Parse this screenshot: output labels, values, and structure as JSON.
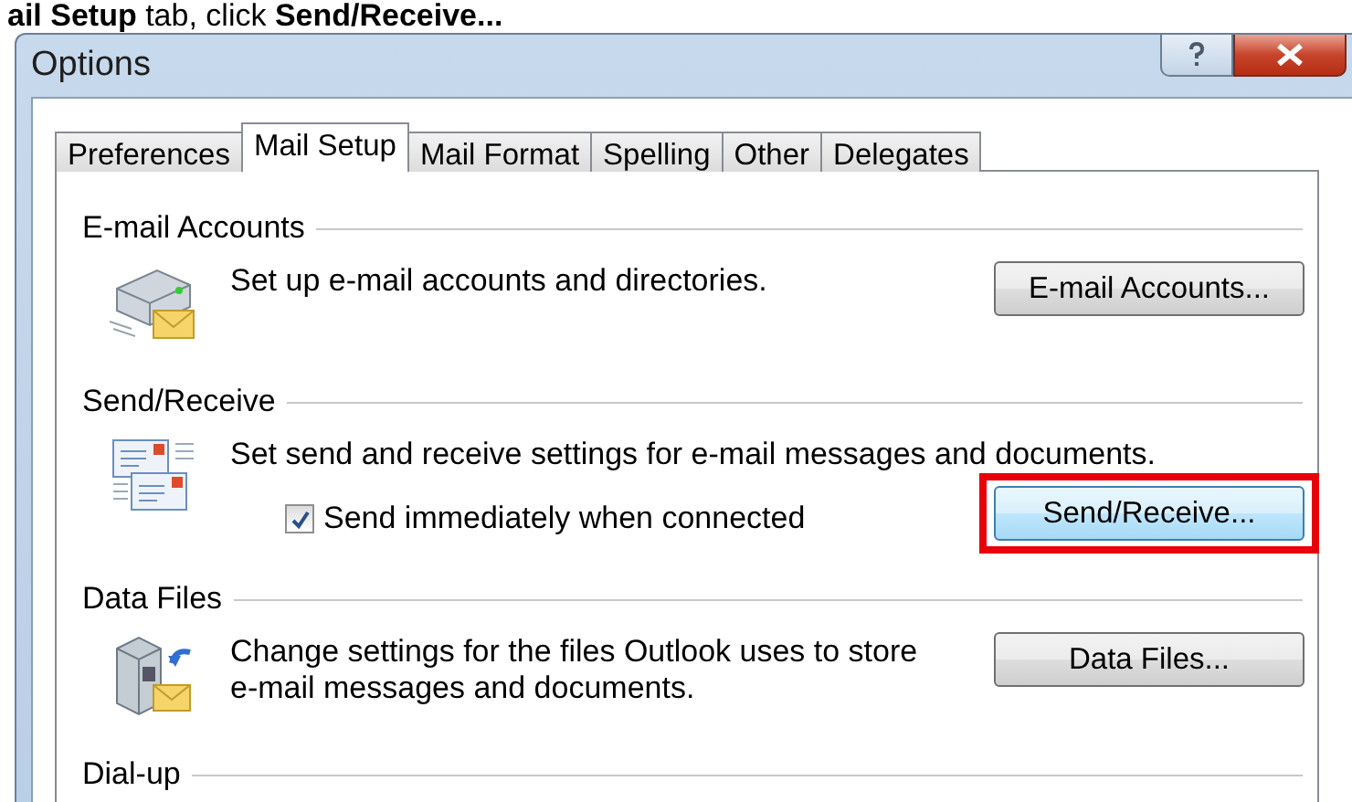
{
  "caption": "**ail Setup** tab, click **Send/Receive...**",
  "window": {
    "title": "Options"
  },
  "tabs": [
    {
      "label": "Preferences",
      "selected": false
    },
    {
      "label": "Mail Setup",
      "selected": true
    },
    {
      "label": "Mail Format",
      "selected": false
    },
    {
      "label": "Spelling",
      "selected": false
    },
    {
      "label": "Other",
      "selected": false
    },
    {
      "label": "Delegates",
      "selected": false
    }
  ],
  "sections": [
    {
      "heading": "E-mail Accounts",
      "kind": "accounts",
      "description": "Set up e-mail accounts and directories.",
      "button": "E-mail Accounts...",
      "highlighted": false
    },
    {
      "heading": "Send/Receive",
      "kind": "sendreceive",
      "description": "Set send and receive settings for e-mail messages and documents.",
      "checkbox": {
        "label": "Send immediately when connected",
        "checked": true
      },
      "button": "Send/Receive...",
      "highlighted": true
    },
    {
      "heading": "Data Files",
      "kind": "datafiles",
      "description": "Change settings for the files Outlook uses to store e-mail messages and documents.",
      "button": "Data Files...",
      "highlighted": false
    },
    {
      "heading": "Dial-up",
      "kind": "heading"
    }
  ]
}
